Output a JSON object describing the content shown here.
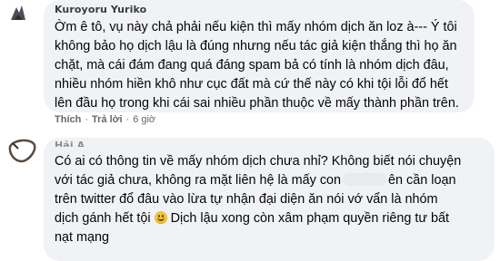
{
  "comments": [
    {
      "author": "Kuroyoru Yuriko",
      "lines": [
        "Ờm ê tô, vụ này chả phải nếu kiện thì mấy nhóm dịch ăn loz à--- Ý tôi",
        "không bảo họ dịch lậu là đúng nhưng nếu tác giả kiện thắng thì họ ăn",
        "chặt, mà cái đám đang quá đáng spam bả có tính là nhóm dịch đâu,",
        "nhiều nhóm hiền khô như cục đất mà cứ thế này có khi tội lỗi đổ hết",
        "lên đầu họ trong khi cái sai nhiều phần thuộc về mấy thành phần trên."
      ],
      "like_label": "Thích",
      "reply_label": "Trả lời",
      "time": "6 giờ"
    },
    {
      "author": "Hải A",
      "line1": "Có ai có thông tin về mấy nhóm dịch chưa nhỉ? Không biết nói chuyện",
      "line2_before": "với tác giả chưa, không ra mặt liên hệ là mấy con",
      "line2_after": "ên cần loạn",
      "line3": "trên twitter đổ đâu vào lừa tự nhận đại diện ăn nói vớ vẩn là nhóm",
      "line4_before": "dịch gánh hết tội",
      "line4_after": " Dịch lậu xong còn xâm phạm quyền riêng tư bất",
      "line5": "nạt mạng",
      "emoji": "grinning-face-emoji"
    }
  ]
}
